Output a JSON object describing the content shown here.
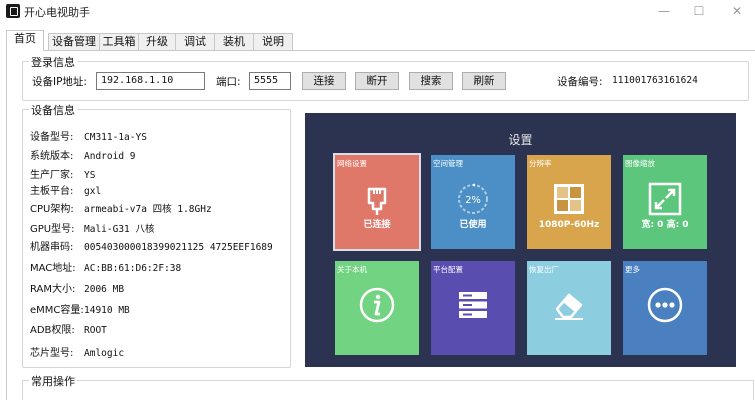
{
  "window": {
    "title": "开心电视助手",
    "controls": [
      "—",
      "☐",
      "✕"
    ]
  },
  "tabs": [
    "首页",
    "设备管理",
    "工具箱",
    "升级",
    "调试",
    "装机",
    "说明"
  ],
  "login": {
    "title": "登录信息",
    "ip_label": "设备IP地址:",
    "ip_value": "192.168.1.10",
    "port_label": "端口:",
    "port_value": "5555",
    "buttons": {
      "connect": "连接",
      "disconnect": "断开",
      "search": "搜索",
      "refresh": "刷新"
    },
    "device_no_label": "设备编号:",
    "device_no_value": "111001763161624"
  },
  "device_info": {
    "title": "设备信息",
    "rows": [
      {
        "key": "设备型号:",
        "value": "CM311-1a-YS"
      },
      {
        "key": "系统版本:",
        "value": "Android 9"
      },
      {
        "key": "生产厂家:",
        "value": "YS"
      },
      {
        "key": "主板平台:",
        "value": "gxl"
      },
      {
        "key": "CPU架构:",
        "value": "armeabi-v7a 四核 1.8GHz"
      },
      {
        "key": "GPU型号:",
        "value": "Mali-G31 八核"
      },
      {
        "key": "机器串码:",
        "value": "005403000018399021125 4725EEF1689"
      },
      {
        "key": "MAC地址:",
        "value": "AC:BB:61:D6:2F:38"
      },
      {
        "key": "RAM大小:",
        "value": "2006 MB"
      },
      {
        "key": "eMMC容量:",
        "value": "14910 MB"
      },
      {
        "key": "ADB权限:",
        "value": "ROOT"
      },
      {
        "key": "芯片型号:",
        "value": "Amlogic"
      }
    ]
  },
  "settings": {
    "title": "设置",
    "tiles": [
      {
        "name": "网络设置",
        "value": "已连接",
        "icon": "ethernet-icon",
        "color": "#e0786a"
      },
      {
        "name": "空间管理",
        "value": "已使用",
        "icon": "storage-ring-icon",
        "color": "#4b8fc6",
        "ring_text": "2%"
      },
      {
        "name": "分辨率",
        "value": "1080P-60Hz",
        "icon": "resolution-grid-icon",
        "color": "#d9a54c"
      },
      {
        "name": "图像缩放",
        "value": "宽: 0 高: 0",
        "icon": "expand-icon",
        "color": "#5cc77c"
      },
      {
        "name": "关于本机",
        "value": "",
        "icon": "info-icon",
        "color": "#72d382"
      },
      {
        "name": "平台配置",
        "value": "",
        "icon": "server-icon",
        "color": "#5a4db0"
      },
      {
        "name": "恢复出厂",
        "value": "",
        "icon": "eraser-icon",
        "color": "#8ccde0"
      },
      {
        "name": "更多",
        "value": "",
        "icon": "more-icon",
        "color": "#4a7fc0"
      }
    ]
  },
  "common_ops": {
    "title": "常用操作"
  }
}
